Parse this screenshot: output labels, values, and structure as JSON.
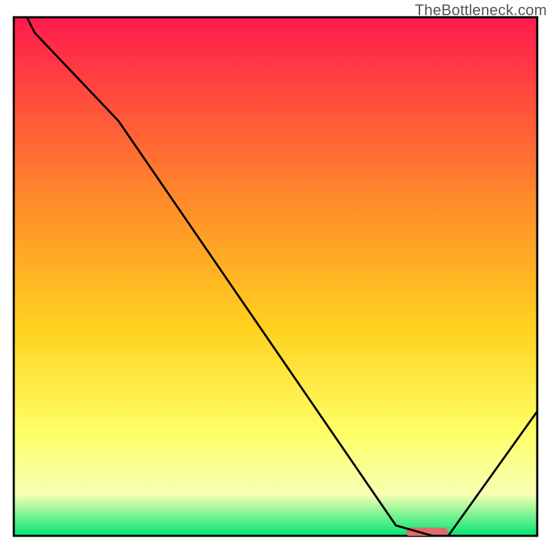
{
  "watermark": "TheBottleneck.com",
  "colors": {
    "border": "#000000",
    "curve": "#000000",
    "marker_fill": "#e06b6b",
    "grad_top": "#ff1a4d",
    "grad_mid1": "#ff8a2a",
    "grad_mid2": "#ffd21f",
    "grad_mid3": "#ffff66",
    "grad_mid4": "#f7ffb3",
    "grad_bottom": "#00e673"
  },
  "chart_data": {
    "type": "line",
    "title": "",
    "xlabel": "",
    "ylabel": "",
    "xlim": [
      0,
      100
    ],
    "ylim": [
      0,
      100
    ],
    "x": [
      0,
      4,
      20,
      73,
      80,
      83,
      100
    ],
    "values": [
      105,
      97,
      80,
      2,
      0,
      0,
      24
    ],
    "optimum_marker": {
      "x_start": 75,
      "x_end": 83,
      "y": 0
    },
    "notes": "Values on an arbitrary 0–100 vertical scale; curve starts above the visible top edge, has a slight knee near x≈20, descends nearly linearly to a flat minimum around x≈75–83 (highlighted), then rises toward x=100."
  }
}
